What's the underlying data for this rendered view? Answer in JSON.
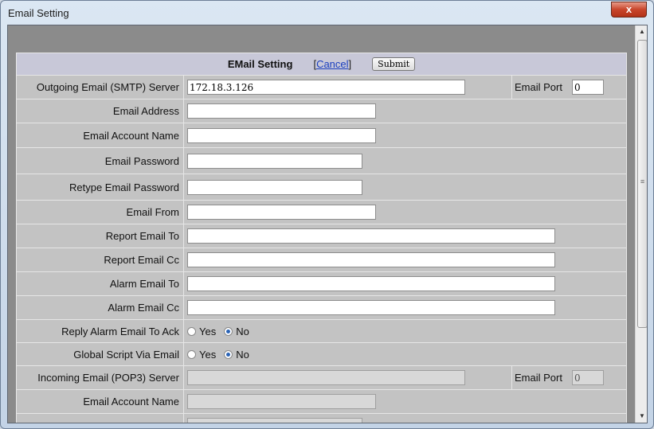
{
  "window": {
    "title": "Email Setting",
    "close_label": "x"
  },
  "header": {
    "title": "EMail Setting",
    "cancel_label": "Cancel",
    "submit_label": "Submit"
  },
  "smtp": {
    "label": "Outgoing Email (SMTP) Server",
    "value": "172.18.3.126",
    "port_label": "Email Port",
    "port_value": "0"
  },
  "fields": {
    "email_address": {
      "label": "Email Address",
      "value": ""
    },
    "account_name": {
      "label": "Email Account Name",
      "value": ""
    },
    "password": {
      "label": "Email Password",
      "value": ""
    },
    "retype_password": {
      "label": "Retype Email Password",
      "value": ""
    },
    "email_from": {
      "label": "Email From",
      "value": ""
    },
    "report_to": {
      "label": "Report Email To",
      "value": ""
    },
    "report_cc": {
      "label": "Report Email Cc",
      "value": ""
    },
    "alarm_to": {
      "label": "Alarm Email To",
      "value": ""
    },
    "alarm_cc": {
      "label": "Alarm Email Cc",
      "value": ""
    }
  },
  "reply_alarm": {
    "label": "Reply Alarm Email To Ack",
    "yes": "Yes",
    "no": "No",
    "selected": "No"
  },
  "global_script": {
    "label": "Global Script Via Email",
    "yes": "Yes",
    "no": "No",
    "selected": "No"
  },
  "pop3": {
    "label": "Incoming Email (POP3) Server",
    "value": "",
    "port_label": "Email Port",
    "port_value": "0"
  },
  "pop3_account": {
    "label": "Email Account Name",
    "value": ""
  }
}
